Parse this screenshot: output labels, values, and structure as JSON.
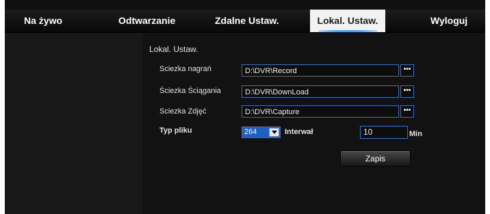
{
  "nav": {
    "items": [
      {
        "label": "Na żywo",
        "active": false
      },
      {
        "label": "Odtwarzanie",
        "active": false
      },
      {
        "label": "Zdalne Ustaw.",
        "active": false
      },
      {
        "label": "Lokal. Ustaw.",
        "active": true
      },
      {
        "label": "Wyloguj",
        "active": false
      }
    ]
  },
  "settings": {
    "title": "Lokal. Ustaw.",
    "record_path": {
      "label": "Sciezka nagrań",
      "value": "D:\\DVR\\Record",
      "browse_label": "•••"
    },
    "download_path": {
      "label": "Ściezka Ściągania",
      "value": "D:\\DVR\\DownLoad",
      "browse_label": "•••"
    },
    "capture_path": {
      "label": "Sciezka Zdjęć",
      "value": "D:\\DVR\\Capture",
      "browse_label": "•••"
    },
    "file_type": {
      "label": "Typ pliku",
      "selected": "264"
    },
    "interval": {
      "label": "Interwał",
      "value": "10",
      "unit": "Min"
    },
    "save_label": "Zapis"
  },
  "colors": {
    "background": "#121212",
    "accent": "#3b6fb7",
    "active_tab": "#f2f2f2",
    "select_highlight": "#1f5fc2"
  }
}
